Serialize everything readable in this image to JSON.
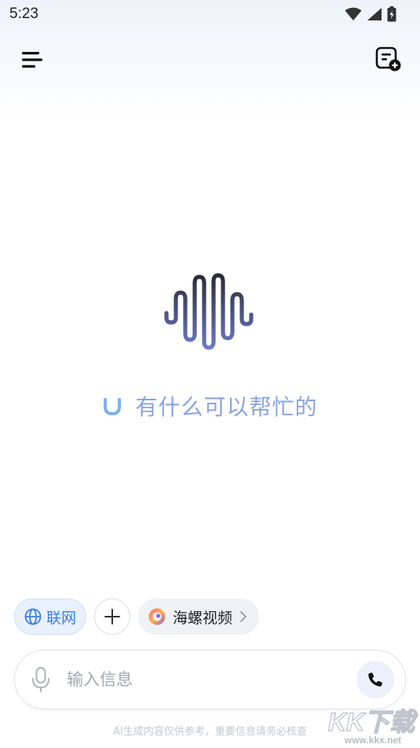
{
  "status_bar": {
    "time": "5:23",
    "icons": [
      "wifi-icon",
      "signal-icon",
      "battery-icon"
    ]
  },
  "header": {
    "menu_icon": "menu-icon",
    "new_chat_icon": "new-chat-icon"
  },
  "hero": {
    "logo_icon": "soundwave-logo-icon"
  },
  "greeting": {
    "icon": "smile-icon",
    "text": "有什么可以帮忙的"
  },
  "chips": [
    {
      "label": "联网",
      "icon": "globe-icon"
    },
    {
      "label": "",
      "icon": "plus-icon"
    },
    {
      "label": "海螺视频",
      "icon": "hailuo-logo-icon"
    }
  ],
  "input": {
    "placeholder": "输入信息",
    "value": ""
  },
  "disclaimer": "AI生成内容仅供参考，重要信息请务必核查",
  "watermark": {
    "text": "KK下载",
    "url": "www.kkx.net"
  },
  "colors": {
    "accent": "#3b7de8",
    "greeting": "#8aa3e0",
    "chip_web_bg": "#e8f1fd",
    "logo_top": "#2b2b36",
    "logo_bottom": "#6a78c8"
  }
}
